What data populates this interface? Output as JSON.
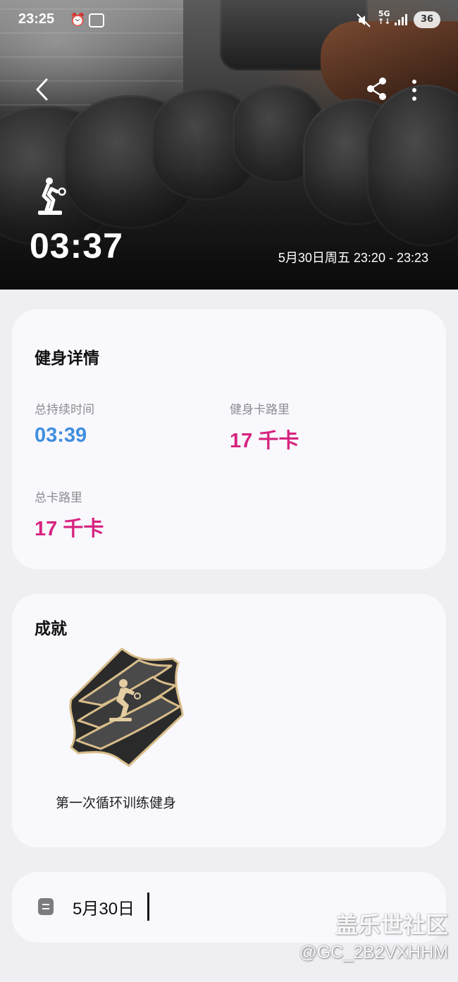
{
  "status_bar": {
    "time": "23:25",
    "network": "5G",
    "battery": "36"
  },
  "hero": {
    "duration": "03:37",
    "date_range": "5月30日周五 23:20 - 23:23"
  },
  "details": {
    "title": "健身详情",
    "stats": [
      {
        "label": "总持续时间",
        "value": "03:39"
      },
      {
        "label": "健身卡路里",
        "value": "17 千卡"
      },
      {
        "label": "总卡路里",
        "value": "17 千卡"
      }
    ]
  },
  "achievements": {
    "title": "成就",
    "badge_name": "第一次循环训练健身"
  },
  "note": {
    "text": "5月30日"
  },
  "watermark": {
    "site": "盖乐世社区",
    "user": "@GC_2B2VXHHM"
  },
  "colors": {
    "duration_value": "#3f8ee0",
    "calorie_value": "#d6237f",
    "card_background": "#f9f8fd",
    "page_background": "#efeef3"
  },
  "icons": [
    "alarm-icon",
    "screen-record-icon",
    "mute-icon",
    "signal-icon",
    "back-icon",
    "share-icon",
    "more-icon",
    "circuit-training-icon",
    "note-icon"
  ]
}
